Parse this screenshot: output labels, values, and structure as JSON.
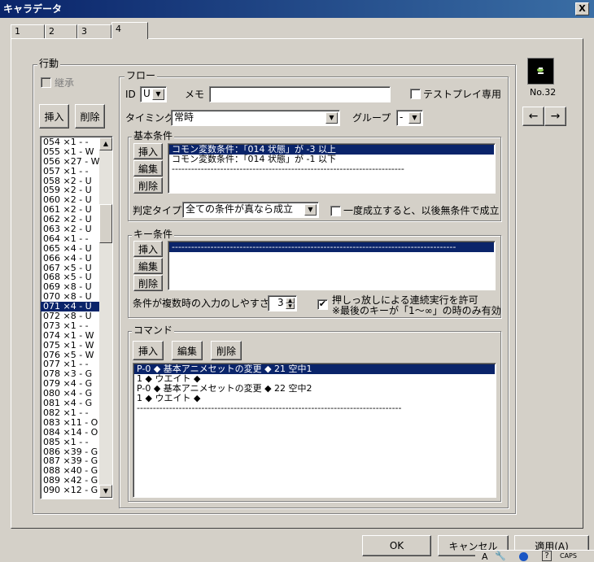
{
  "window": {
    "title": "キャラデータ",
    "close_label": "X"
  },
  "tabs": [
    "1",
    "2",
    "3",
    "4"
  ],
  "action": {
    "legend": "行動",
    "inherit_label": "継承",
    "insert_label": "挿入",
    "delete_label": "削除",
    "items": [
      "054 ×1 - -",
      "055 ×1 - W",
      "056 ×27 - W",
      "057 ×1 - -",
      "058 ×2 - U",
      "059 ×2 - U",
      "060 ×2 - U",
      "061 ×2 - U",
      "062 ×2 - U",
      "063 ×2 - U",
      "064 ×1 - -",
      "065 ×4 - U",
      "066 ×4 - U",
      "067 ×5 - U",
      "068 ×5 - U",
      "069 ×8 - U",
      "070 ×8 - U",
      "071 ×4 - U",
      "072 ×8 - U",
      "073 ×1 - -",
      "074 ×1 - W",
      "075 ×1 - W",
      "076 ×5 - W",
      "077 ×1 - -",
      "078 ×3 - G",
      "079 ×4 - G",
      "080 ×4 - G",
      "081 ×4 - G",
      "082 ×1 - -",
      "083 ×11 - O",
      "084 ×14 - O",
      "085 ×1 - -",
      "086 ×39 - G",
      "087 ×39 - G",
      "088 ×40 - G",
      "089 ×42 - G",
      "090 ×12 - G"
    ],
    "selected_index": 17
  },
  "flow": {
    "legend": "フロー",
    "id_label": "ID",
    "id_value": "U",
    "memo_label": "メモ",
    "memo_value": "",
    "test_play_label": "テストプレイ専用",
    "timing_label": "タイミング",
    "timing_value": "常時",
    "group_label": "グループ",
    "group_value": "-"
  },
  "basic_conditions": {
    "legend": "基本条件",
    "insert_label": "挿入",
    "edit_label": "編集",
    "delete_label": "削除",
    "items": [
      "コモン変数条件：「014 状態」が -3 以上",
      "コモン変数条件：「014 状態」が -1 以下",
      "------------------------------------------------------------------------"
    ],
    "selected_index": 0,
    "judge_type_label": "判定タイプ",
    "judge_type_value": "全ての条件が真なら成立",
    "once_label": "一度成立すると、以後無条件で成立"
  },
  "key_conditions": {
    "legend": "キー条件",
    "insert_label": "挿入",
    "edit_label": "編集",
    "delete_label": "削除",
    "items": [
      "----------------------------------------------------------------------------------------"
    ],
    "selected_index": 0,
    "ease_label": "条件が複数時の入力のしやすさ",
    "ease_value": "3",
    "hold_label": "押しっ放しによる連続実行を許可",
    "hold_note": "※最後のキーが「1～∞」の時のみ有効",
    "hold_checked": "✔"
  },
  "commands": {
    "legend": "コマンド",
    "insert_label": "挿入",
    "edit_label": "編集",
    "delete_label": "削除",
    "items": [
      "P-0 ◆ 基本アニメセットの変更 ◆ 21 空中1",
      "1 ◆ ウエイト ◆",
      "P-0 ◆ 基本アニメセットの変更 ◆ 22 空中2",
      "1 ◆ ウエイト ◆",
      "----------------------------------------------------------------------------------"
    ],
    "selected_index": 0
  },
  "preview": {
    "number_label": "No.32",
    "prev_label": "←",
    "next_label": "→"
  },
  "footer": {
    "ok_label": "OK",
    "cancel_label": "キャンセル",
    "apply_label": "適用(A)"
  },
  "tray": {
    "caps_label": "CAPS",
    "ime_label": "A"
  }
}
